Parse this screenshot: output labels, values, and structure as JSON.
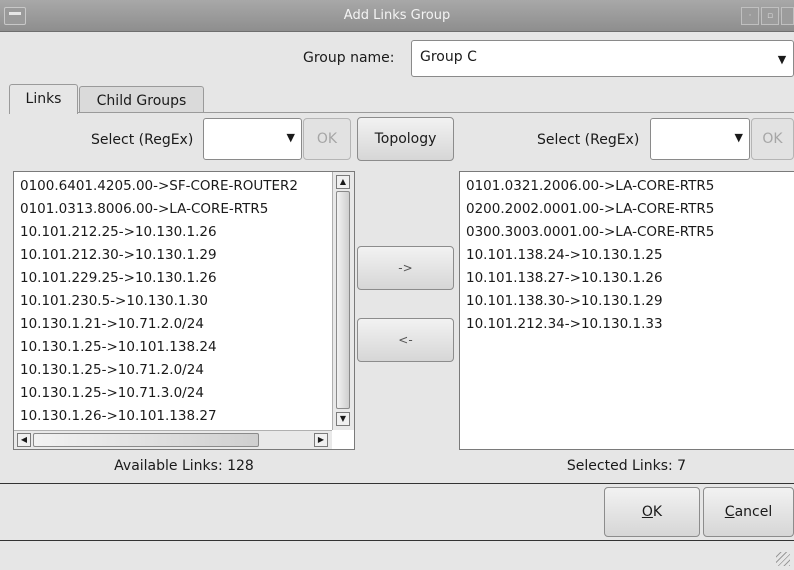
{
  "window": {
    "title": "Add Links Group",
    "icons": {
      "menu": "window-menu-icon",
      "minimize": "minimize-icon",
      "maximize": "maximize-icon",
      "close": "close-icon"
    }
  },
  "group": {
    "label": "Group name:",
    "value": "Group C",
    "arrow": "chevron-down-icon"
  },
  "tabs": [
    {
      "label": "Links",
      "active": true
    },
    {
      "label": "Child Groups",
      "active": false
    }
  ],
  "left": {
    "select_label": "Select (RegEx)",
    "select_value": "",
    "ok_label": "OK",
    "items": [
      "0100.6401.4205.00->SF-CORE-ROUTER2",
      "0101.0313.8006.00->LA-CORE-RTR5",
      "10.101.212.25->10.130.1.26",
      "10.101.212.30->10.130.1.29",
      "10.101.229.25->10.130.1.26",
      "10.101.230.5->10.130.1.30",
      "10.130.1.21->10.71.2.0/24",
      "10.130.1.25->10.101.138.24",
      "10.130.1.25->10.71.2.0/24",
      "10.130.1.25->10.71.3.0/24",
      "10.130.1.26->10.101.138.27"
    ],
    "count_label": "Available Links: 128"
  },
  "middle": {
    "topology_label": "Topology",
    "add_label": "->",
    "remove_label": "<-"
  },
  "right": {
    "select_label": "Select (RegEx)",
    "select_value": "",
    "ok_label": "OK",
    "items": [
      "0101.0321.2006.00->LA-CORE-RTR5",
      "0200.2002.0001.00->LA-CORE-RTR5",
      "0300.3003.0001.00->LA-CORE-RTR5",
      "10.101.138.24->10.130.1.25",
      "10.101.138.27->10.130.1.26",
      "10.101.138.30->10.130.1.29",
      "10.101.212.34->10.130.1.33"
    ],
    "count_label": "Selected Links: 7"
  },
  "footer": {
    "ok_label": "OK",
    "cancel_label": "Cancel"
  }
}
